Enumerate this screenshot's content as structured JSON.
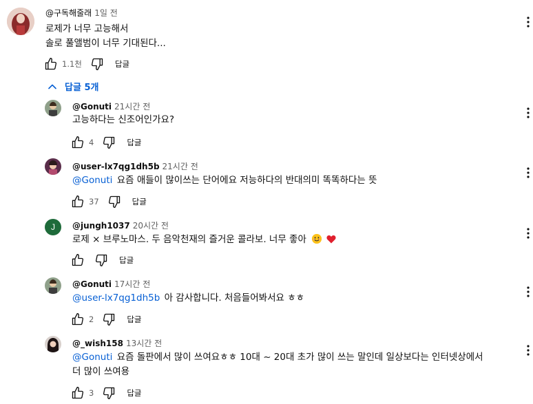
{
  "top_comment": {
    "author": "@구독해줄래",
    "time": "1일 전",
    "lines": [
      "로제가 너무 고능해서",
      "솔로 풀앨범이 너무 기대된다..."
    ],
    "likes": "1.1천",
    "reply_label": "답글"
  },
  "replies_toggle": {
    "label": "답글 5개",
    "icon": "chevron-up-icon"
  },
  "replies": [
    {
      "author": "@Gonuti",
      "time": "21시간 전",
      "mention": "",
      "text": "고능하다는 신조어인가요?",
      "text2": "",
      "likes": "4",
      "reply_label": "답글",
      "avatar_color": "#6b7a6a"
    },
    {
      "author": "@user-lx7qg1dh5b",
      "time": "21시간 전",
      "mention": "@Gonuti",
      "text": "요즘 애들이 많이쓰는 단어에요 저능하다의 반대의미 똑똑하다는 뜻",
      "text2": "",
      "likes": "37",
      "reply_label": "답글",
      "avatar_color": "#7a3a5a"
    },
    {
      "author": "@jungh1037",
      "time": "20시간 전",
      "mention": "",
      "text": "로제 × 브루노마스. 두 음악천재의 즐거운 콜라보. 너무 좋아",
      "text2": "",
      "likes": "",
      "reply_label": "답글",
      "avatar_letter": "J",
      "avatar_color": "#1e6b3a"
    },
    {
      "author": "@Gonuti",
      "time": "17시간 전",
      "mention": "@user-lx7qg1dh5b",
      "text": "아 감사합니다. 처음들어봐서요 ㅎㅎ",
      "text2": "",
      "likes": "2",
      "reply_label": "답글",
      "avatar_color": "#6b7a6a"
    },
    {
      "author": "@_wish158",
      "time": "13시간 전",
      "mention": "@Gonuti",
      "text": "요즘 돌판에서 많이 쓰여요ㅎㅎ 10대 ~ 20대 초가 많이 쓰는 말인데 일상보다는 인터넷상에서",
      "text2": "더 많이 쓰여용",
      "likes": "3",
      "reply_label": "답글",
      "avatar_color": "#3a2a2a"
    }
  ],
  "colors": {
    "link": "#065fd4",
    "secondary_text": "#606060",
    "text": "#0f0f0f"
  }
}
